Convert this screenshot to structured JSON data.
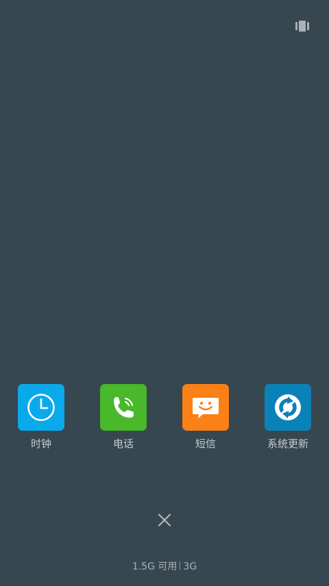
{
  "apps": [
    {
      "label": "时钟",
      "icon": "clock-icon",
      "color": "#0aa9ec"
    },
    {
      "label": "电话",
      "icon": "phone-icon",
      "color": "#49b82a"
    },
    {
      "label": "短信",
      "icon": "message-icon",
      "color": "#fb8016"
    },
    {
      "label": "系统更新",
      "icon": "system-update-icon",
      "color": "#0b82b7"
    }
  ],
  "memory": {
    "available": "1.5G 可用",
    "total": "3G"
  },
  "colors": {
    "background": "#36474f"
  }
}
